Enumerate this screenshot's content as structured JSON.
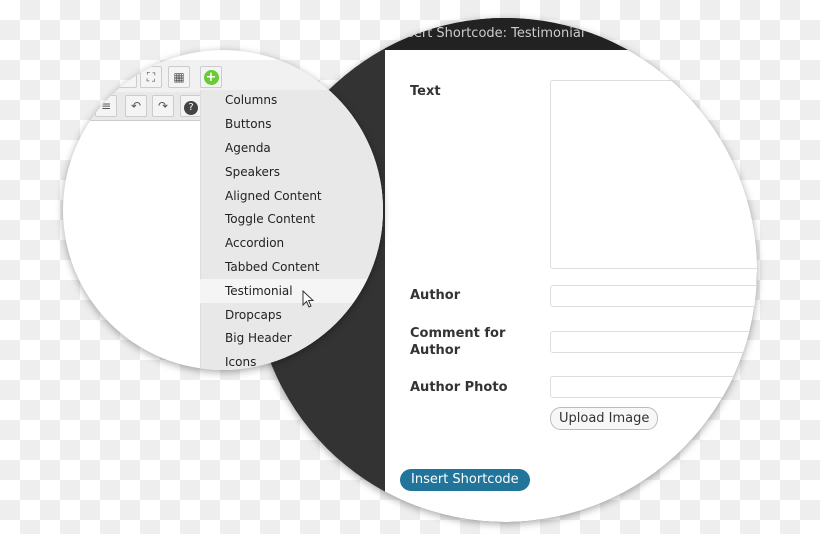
{
  "dialog": {
    "title": "Insert Shortcode: Testimonial",
    "fields": [
      {
        "label": "Text",
        "value": ""
      },
      {
        "label": "Author",
        "value": ""
      },
      {
        "label": "Comment for Author",
        "value": ""
      },
      {
        "label": "Author Photo",
        "value": ""
      }
    ],
    "upload_label": "Upload Image",
    "insert_label": "Insert Shortcode",
    "accent": "#21759b"
  },
  "editor": {
    "toolbar_icons": [
      "fullscreen-icon",
      "kitchen-sink-icon",
      "add-shortcode-icon",
      "indent-icon",
      "undo-icon",
      "redo-icon",
      "help-icon"
    ],
    "menu_items": [
      "Columns",
      "Buttons",
      "Agenda",
      "Speakers",
      "Aligned Content",
      "Toggle Content",
      "Accordion",
      "Tabbed Content",
      "Testimonial",
      "Dropcaps",
      "Big Header",
      "Icons"
    ],
    "hovered_item": "Testimonial"
  }
}
